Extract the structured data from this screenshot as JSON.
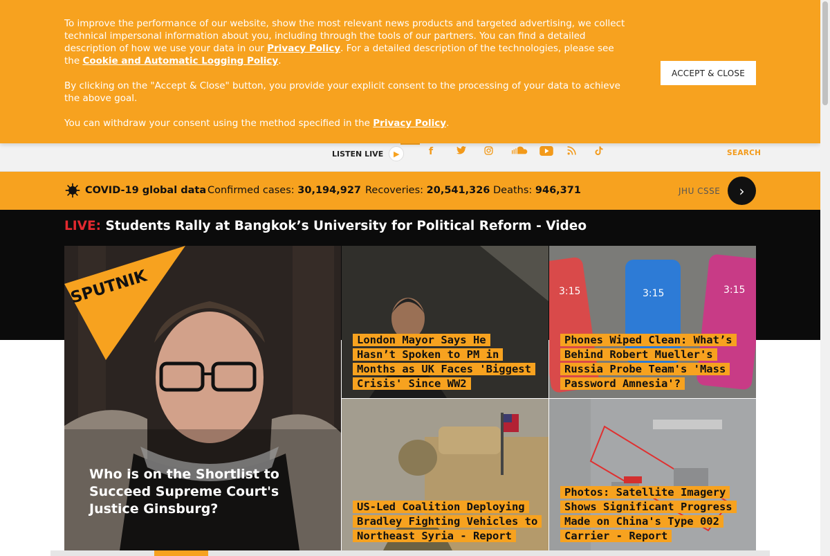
{
  "cookie": {
    "para1_a": "To improve the performance of our website, show the most relevant news products and targeted advertising, we collect technical impersonal information about you, including through the tools of our partners. You can find a detailed description of how we use your data in our ",
    "para1_link1": "Privacy Policy",
    "para1_b": ". For a detailed description of the technologies, please see the ",
    "para1_link2": "Cookie and Automatic Logging Policy",
    "para1_c": ".",
    "para2": "By clicking on the \"Accept & Close\" button, you provide your explicit consent to the processing of your data to achieve the above goal.",
    "para3_a": "You can withdraw your consent using the method specified in the ",
    "para3_link": "Privacy Policy",
    "para3_c": ".",
    "accept_label": "ACCEPT & CLOSE"
  },
  "header": {
    "listen_label": "LISTEN LIVE",
    "socials": [
      "facebook-icon",
      "twitter-icon",
      "instagram-icon",
      "soundcloud-icon",
      "youtube-icon",
      "rss-icon",
      "tiktok-icon"
    ],
    "search_label": "SEARCH"
  },
  "covid": {
    "title": "COVID-19 global data",
    "confirmed_label": "Confirmed cases:",
    "confirmed_value": "30,194,927",
    "recoveries_label": "Recoveries:",
    "recoveries_value": "20,541,326",
    "deaths_label": "Deaths:",
    "deaths_value": "946,371",
    "source": "JHU CSSE"
  },
  "live": {
    "tag": "LIVE:",
    "title": "Students Rally at Bangkok’s University for Political Reform - Video"
  },
  "logo_text": "SPUTNIK",
  "articles": {
    "main": "Who is on the Shortlist to Succeed Supreme Court's Justice Ginsburg?",
    "t1": [
      "London Mayor Says He",
      "Hasn’t Spoken to PM in",
      "Months as UK Faces 'Biggest",
      "Crisis' Since WW2"
    ],
    "t2": [
      "Phones Wiped Clean: What’s",
      "Behind Robert Mueller's",
      "Russia Probe Team's 'Mass",
      "Password Amnesia'?"
    ],
    "t3": [
      "US-Led Coalition Deploying",
      "Bradley Fighting Vehicles to",
      "Northeast Syria - Report"
    ],
    "t4": [
      "Photos: Satellite Imagery",
      "Shows Significant Progress",
      "Made on China's Type 002",
      "Carrier - Report"
    ]
  },
  "colors": {
    "accent": "#f7a21f",
    "live_red": "#e3292f",
    "dark": "#0b0b0b"
  }
}
